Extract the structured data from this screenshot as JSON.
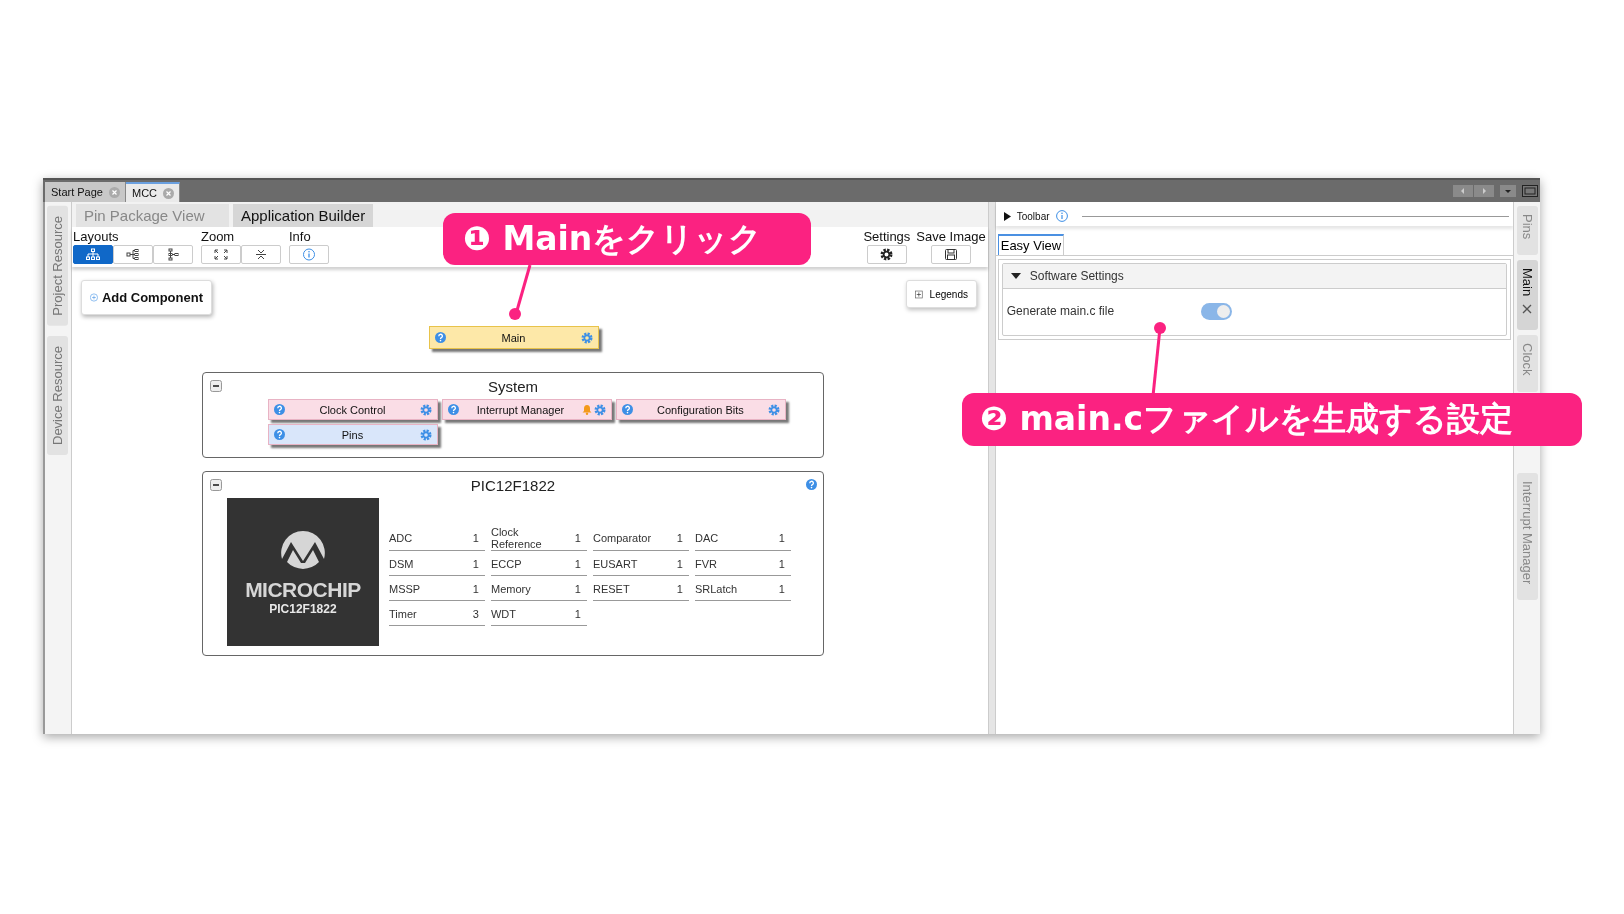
{
  "editor_tabs": [
    {
      "label": "Start Page",
      "selected": false
    },
    {
      "label": "MCC",
      "selected": true
    }
  ],
  "left_side_tabs": [
    {
      "label": "Project Resource"
    },
    {
      "label": "Device Resource"
    }
  ],
  "view_tabs": [
    {
      "label": "Pin Package View",
      "selected": false
    },
    {
      "label": "Application Builder",
      "selected": true
    }
  ],
  "toolbar": {
    "groups": [
      {
        "label": "Layouts",
        "kind": "layouts",
        "buttons": [
          {
            "selected": true
          },
          {
            "selected": false
          },
          {
            "selected": false
          }
        ]
      },
      {
        "label": "Zoom",
        "kind": "zoom",
        "buttons": [
          {
            "selected": false
          },
          {
            "selected": false
          }
        ]
      },
      {
        "label": "Info",
        "kind": "info",
        "buttons": [
          {
            "selected": false
          }
        ]
      }
    ],
    "right_groups": [
      {
        "label": "Settings",
        "kind": "settings",
        "buttons": [
          {
            "selected": false
          }
        ]
      },
      {
        "label": "Save Image",
        "kind": "save",
        "buttons": [
          {
            "selected": false
          }
        ]
      }
    ]
  },
  "add_component": {
    "label": "Add Component"
  },
  "legends": {
    "label": "Legends"
  },
  "main_node": {
    "label": "Main"
  },
  "system": {
    "title": "System",
    "expanded": true,
    "components": [
      {
        "label": "Clock Control",
        "color": "#fadde6",
        "alert": false
      },
      {
        "label": "Interrupt Manager",
        "color": "#fadde6",
        "alert": true
      },
      {
        "label": "Configuration Bits",
        "color": "#fadde6",
        "alert": false
      },
      {
        "label": "Pins",
        "color": "#d9e6fa",
        "alert": false
      }
    ]
  },
  "device": {
    "title": "PIC12F1822",
    "expanded": true,
    "logo_text": "MICROCHIP",
    "chip_label": "PIC12F1822",
    "peripherals": [
      {
        "name": "ADC",
        "count": "1"
      },
      {
        "name": "Clock Reference",
        "count": "1"
      },
      {
        "name": "Comparator",
        "count": "1"
      },
      {
        "name": "DAC",
        "count": "1"
      },
      {
        "name": "DSM",
        "count": "1"
      },
      {
        "name": "ECCP",
        "count": "1"
      },
      {
        "name": "EUSART",
        "count": "1"
      },
      {
        "name": "FVR",
        "count": "1"
      },
      {
        "name": "MSSP",
        "count": "1"
      },
      {
        "name": "Memory",
        "count": "1"
      },
      {
        "name": "RESET",
        "count": "1"
      },
      {
        "name": "SRLatch",
        "count": "1"
      },
      {
        "name": "Timer",
        "count": "3"
      },
      {
        "name": "WDT",
        "count": "1"
      }
    ]
  },
  "right_panel": {
    "toolbar_label": "Toolbar",
    "tabs": [
      {
        "label": "Easy View",
        "selected": true
      }
    ],
    "sections": [
      {
        "title": "Software Settings",
        "expanded": true,
        "settings": [
          {
            "label": "Generate main.c file",
            "kind": "toggle",
            "on": true
          }
        ]
      }
    ]
  },
  "right_side_tabs": [
    {
      "label": "Pins",
      "selected": false,
      "closable": false
    },
    {
      "label": "Main",
      "selected": true,
      "closable": true
    },
    {
      "label": "Clock",
      "selected": false,
      "closable": false
    },
    {
      "label": "Interrupt Manager",
      "selected": false,
      "closable": false
    }
  ],
  "callouts": [
    {
      "text": "❶ Mainをクリック"
    },
    {
      "text": "❷ main.cファイルを生成する設定"
    }
  ]
}
